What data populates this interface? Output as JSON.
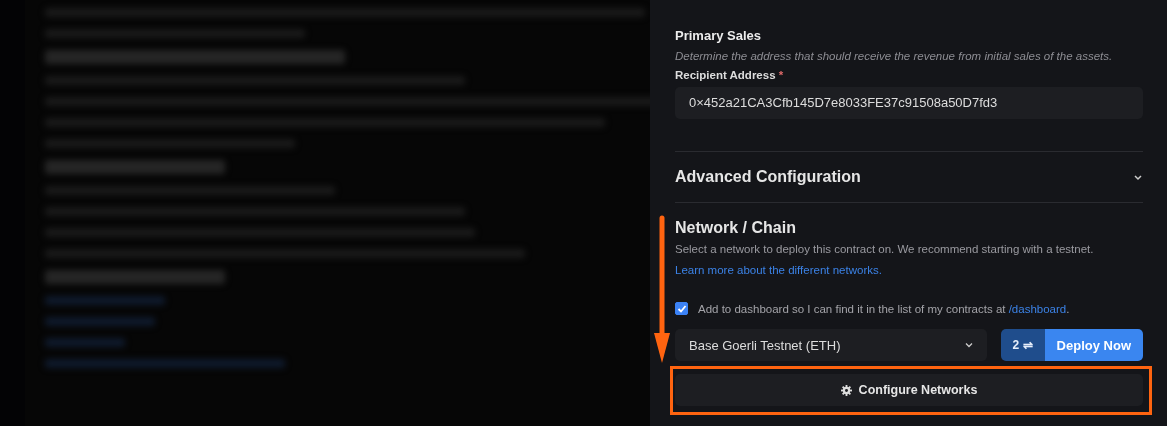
{
  "primary_sales": {
    "title": "Primary Sales",
    "description": "Determine the address that should receive the revenue from initial sales of the assets.",
    "field_label": "Recipient Address",
    "required_mark": "*",
    "value": "0×452a21CA3Cfb145D7e8033FE37c91508a50D7fd3"
  },
  "advanced": {
    "title": "Advanced Configuration",
    "expanded": false
  },
  "network": {
    "title": "Network / Chain",
    "description": "Select a network to deploy this contract on. We recommend starting with a testnet.",
    "learn_link": "Learn more about the different networks.",
    "dashboard": {
      "checked": true,
      "text": "Add to dashboard so I can find it in the list of my contracts at",
      "link": "/dashboard",
      "trailing": "."
    },
    "select_value": "Base Goerli Testnet (ETH)",
    "count_badge": "2 ⇌",
    "deploy_button": "Deploy Now",
    "configure_button": "Configure Networks"
  }
}
